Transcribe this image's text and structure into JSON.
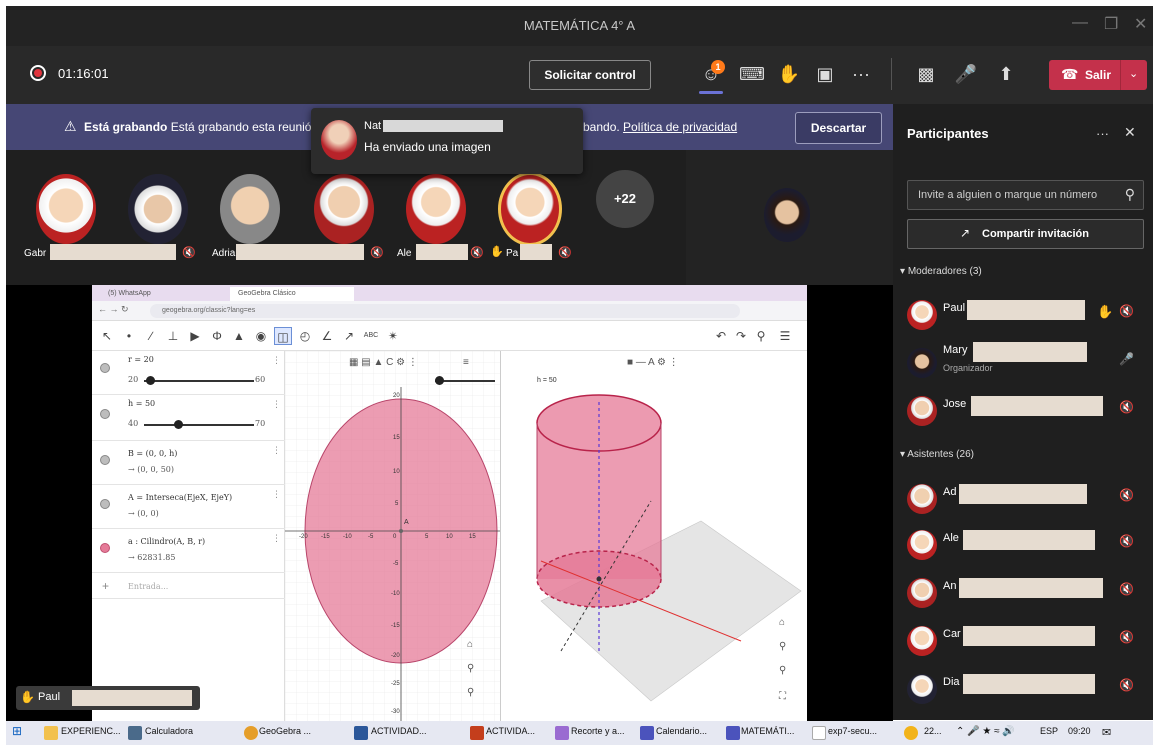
{
  "window": {
    "title": "MATEMÁTICA 4° A",
    "minimize": "—",
    "maximize": "❐",
    "close": "✕"
  },
  "call": {
    "timer": "01:16:01",
    "request_control": "Solicitar control",
    "people_badge": "1",
    "leave": "Salir",
    "more": "···"
  },
  "banner": {
    "bold": "Está grabando",
    "text": "Está grabando esta reunión",
    "text_tail": "bando.",
    "privacy_link": "Política de privacidad",
    "dismiss": "Descartar"
  },
  "toast": {
    "name": "Nat",
    "message": "Ha enviado una imagen"
  },
  "gallery": {
    "names": [
      "Gabr",
      "Adria",
      "Ale",
      "Pa"
    ],
    "more": "+22"
  },
  "share": {
    "hand_name": "Paul"
  },
  "browser": {
    "tabs": [
      "(5) WhatsApp",
      "GeoGebra Clásico"
    ],
    "url": "geogebra.org/classic?lang=es"
  },
  "geogebra": {
    "rows": [
      {
        "t1": "r = 20",
        "t2": "",
        "min": "20",
        "max": "60"
      },
      {
        "t1": "h = 50",
        "t2": "",
        "min": "40",
        "max": "70"
      },
      {
        "t1": "B = (0, 0, h)",
        "t2": "→ (0, 0, 50)"
      },
      {
        "t1": "A = Interseca(EjeX, EjeY)",
        "t2": "→ (0, 0)"
      },
      {
        "t1": "a : Cilindro(A, B, r)",
        "t2": "→ 62831.85"
      }
    ],
    "input_placeholder": "Entrada...",
    "label_A": "A",
    "slider_h": "h = 50",
    "x_ticks": [
      "-20",
      "-15",
      "-10",
      "-5",
      "0",
      "5",
      "10",
      "15"
    ],
    "y_ticks": [
      "20",
      "15",
      "10",
      "5",
      "-5",
      "-10",
      "-15",
      "-20",
      "-25",
      "-30"
    ]
  },
  "panel": {
    "title": "Participantes",
    "search_placeholder": "Invite a alguien o marque un número",
    "invite": "Compartir invitación",
    "moderators_header": "Moderadores (3)",
    "moderators": [
      {
        "name": "Paul",
        "role": "",
        "hand": true
      },
      {
        "name": "Mary",
        "role": "Organizador",
        "hand": false
      },
      {
        "name": "Jose",
        "role": "",
        "hand": false
      }
    ],
    "attendees_header": "Asistentes (26)",
    "attendees": [
      {
        "name": "Ad"
      },
      {
        "name": "Ale"
      },
      {
        "name": "An"
      },
      {
        "name": "Car"
      },
      {
        "name": "Dia"
      }
    ]
  },
  "taskbar": {
    "items": [
      "EXPERIENC...",
      "Calculadora",
      "GeoGebra ...",
      "ACTIVIDAD...",
      "ACTIVIDA...",
      "Recorte y a...",
      "Calendario...",
      "MATEMÁTI...",
      "exp7-secu..."
    ],
    "weather": "22...",
    "lang": "ESP",
    "time": "09:20"
  },
  "colors": {
    "teams_dark": "#292929",
    "banner": "#464775",
    "leave_red": "#c4314b",
    "accent": "#6b72d6",
    "cylinder_pink": "#e57b98"
  }
}
